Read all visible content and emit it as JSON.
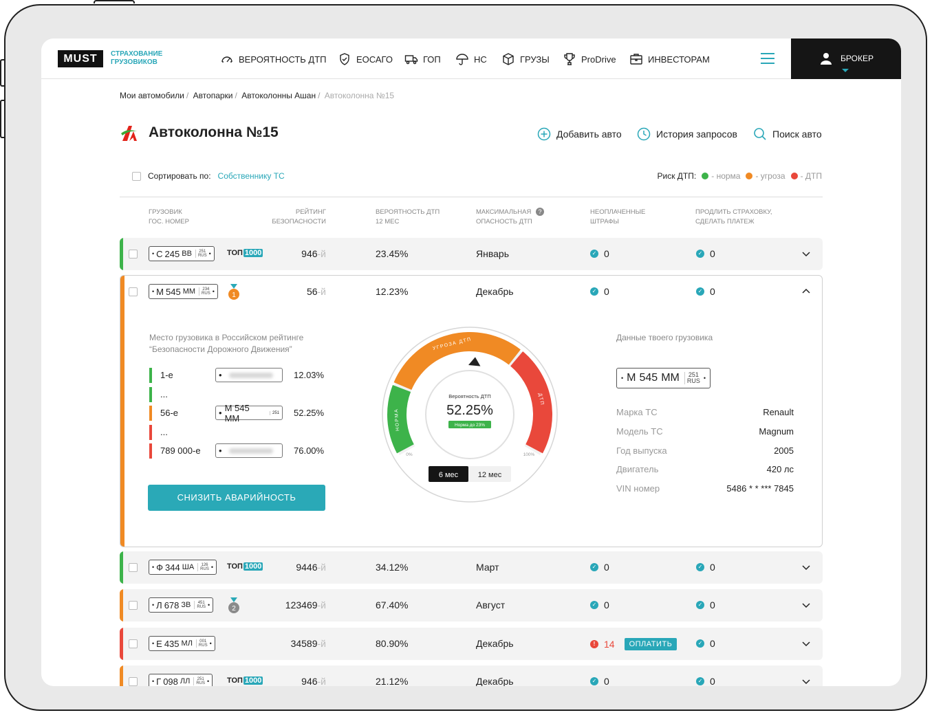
{
  "header": {
    "logo": "MUST",
    "logo_tagline_1": "СТРАХОВАНИЕ",
    "logo_tagline_2": "ГРУЗОВИКОВ",
    "nav": [
      {
        "label": "ВЕРОЯТНОСТЬ ДТП",
        "icon": "speedometer-icon"
      },
      {
        "label": "ЕОСАГО",
        "icon": "shield-icon"
      },
      {
        "label": "ГОП",
        "icon": "truck-icon"
      },
      {
        "label": "НС",
        "icon": "umbrella-icon"
      },
      {
        "label": "ГРУЗЫ",
        "icon": "box-icon"
      },
      {
        "label": "ProDrive",
        "icon": "trophy-icon"
      },
      {
        "label": "ИНВЕСТОРАМ",
        "icon": "briefcase-icon"
      }
    ],
    "user_label": "БРОКЕР"
  },
  "breadcrumb": [
    "Мои автомобили",
    "Автопарки",
    "Автоколонны Ашан",
    "Автоколонна №15"
  ],
  "page_title": "Автоколонна №15",
  "actions": {
    "add": "Добавить авто",
    "history": "История запросов",
    "search": "Поиск авто"
  },
  "sort": {
    "label": "Сортировать по:",
    "value": "Собственнику ТС"
  },
  "risk_legend": {
    "label": "Риск ДТП:",
    "norm": "- норма",
    "threat": "- угроза",
    "accident": "- ДТП",
    "colors": {
      "norm": "#3db34a",
      "threat": "#f08a24",
      "accident": "#e9483b"
    }
  },
  "columns": {
    "truck_1": "ГРУЗОВИК",
    "truck_2": "ГОС. НОМЕР",
    "rating_1": "РЕЙТИНГ",
    "rating_2": "БЕЗОПАСНОСТИ",
    "prob_1": "ВЕРОЯТНОСТЬ ДТП",
    "prob_2": "12 МЕС",
    "max_1": "МАКСИМАЛЬНАЯ",
    "max_2": "ОПАСНОСТЬ ДТП",
    "fines_1": "НЕОПЛАЧЕННЫЕ",
    "fines_2": "ШТРАФЫ",
    "renew_1": "ПРОДЛИТЬ СТРАХОВКУ,",
    "renew_2": "СДЕЛАТЬ ПЛАТЕЖ"
  },
  "rows": [
    {
      "letter": "С",
      "num": "245",
      "series": "ВВ",
      "region": "251",
      "badge": "top1000",
      "rank": "946",
      "prob": "23.45%",
      "month": "Январь",
      "fines": "0",
      "renew": "0",
      "risk": "norm"
    },
    {
      "letter": "М",
      "num": "545",
      "series": "ММ",
      "region": "234",
      "badge": "medal-1",
      "rank": "56",
      "prob": "12.23%",
      "month": "Декабрь",
      "fines": "0",
      "renew": "0",
      "risk": "threat"
    },
    {
      "letter": "Ф",
      "num": "344",
      "series": "ША",
      "region": "126",
      "badge": "top1000",
      "rank": "9446",
      "prob": "34.12%",
      "month": "Март",
      "fines": "0",
      "renew": "0",
      "risk": "norm"
    },
    {
      "letter": "Л",
      "num": "678",
      "series": "ЗВ",
      "region": "451",
      "badge": "medal-2",
      "rank": "123469",
      "prob": "67.40%",
      "month": "Август",
      "fines": "0",
      "renew": "0",
      "risk": "threat"
    },
    {
      "letter": "Е",
      "num": "435",
      "series": "МЛ",
      "region": "001",
      "badge": "",
      "rank": "34589",
      "prob": "80.90%",
      "month": "Декабрь",
      "fines": "14",
      "renew": "0",
      "risk": "accident",
      "pay": "ОПЛАТИТЬ"
    },
    {
      "letter": "Г",
      "num": "098",
      "series": "ЛЛ",
      "region": "251",
      "badge": "top1000",
      "rank": "946",
      "prob": "21.12%",
      "month": "Декабрь",
      "fines": "0",
      "renew": "0",
      "risk": "threat"
    }
  ],
  "rank_suffix": "-й",
  "badge_top": "ТОП",
  "badge_1000": "1000",
  "expanded": {
    "caption_1": "Место грузовика в Российском рейтинге",
    "caption_2": "“Безопасности Дорожного Движения”",
    "ranking": [
      {
        "pos": "1-е",
        "pct": "12.03%",
        "risk": "norm"
      },
      {
        "pos": "...",
        "risk": "norm"
      },
      {
        "pos": "56-е",
        "plate": "М 545 ММ",
        "region": "251",
        "pct": "52.25%",
        "risk": "threat"
      },
      {
        "pos": "...",
        "risk": "accident"
      },
      {
        "pos": "789 000-е",
        "pct": "76.00%",
        "risk": "accident"
      }
    ],
    "reduce_button": "СНИЗИТЬ АВАРИЙНОСТЬ",
    "gauge": {
      "label": "Вероятность ДТП",
      "value": "52.25%",
      "norm_badge": "Норма до 23%",
      "min": "0%",
      "max": "100%",
      "zone_norm": "НОРМА",
      "zone_threat": "УГРОЗА ДТП",
      "zone_accident": "ДТП",
      "pointer_fraction": 0.5225,
      "periods": [
        "6 мес",
        "12 мес"
      ],
      "active_period": "6 мес"
    },
    "truck_data_title": "Данные твоего грузовика",
    "plate": {
      "letter": "М",
      "num": "545",
      "series": "ММ",
      "region": "251"
    },
    "specs": [
      {
        "k": "Марка ТС",
        "v": "Renault"
      },
      {
        "k": "Модель ТС",
        "v": "Magnum"
      },
      {
        "k": "Год выпуска",
        "v": "2005"
      },
      {
        "k": "Двигатель",
        "v": "420 лс"
      },
      {
        "k": "VIN номер",
        "v": "5486 * * *** 7845"
      }
    ]
  }
}
